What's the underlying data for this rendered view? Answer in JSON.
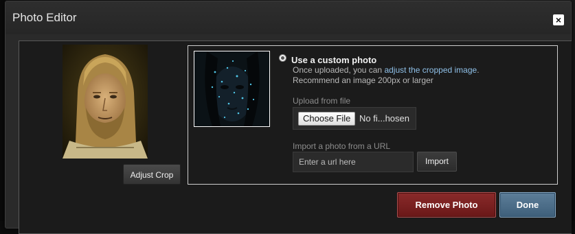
{
  "dialog": {
    "title": "Photo Editor",
    "close_icon": "close-icon",
    "close_glyph": "×"
  },
  "current_photo": {
    "adjust_crop_label": "Adjust Crop"
  },
  "custom_photo": {
    "title": "Use a custom photo",
    "line1_prefix": "Once uploaded, you can ",
    "line1_link": "adjust the cropped image",
    "line1_suffix": ".",
    "line2": "Recommend an image 200px or larger",
    "upload_label": "Upload from file",
    "choose_file_label": "Choose File",
    "no_file_text": "No fi...hosen",
    "import_label": "Import a photo from a URL",
    "url_placeholder": "Enter a url here",
    "import_button": "Import"
  },
  "actions": {
    "remove_label": "Remove Photo",
    "done_label": "Done"
  },
  "colors": {
    "link": "#8fc0e8",
    "remove_button": "#7a2020",
    "done_button": "#4e6f8a"
  }
}
